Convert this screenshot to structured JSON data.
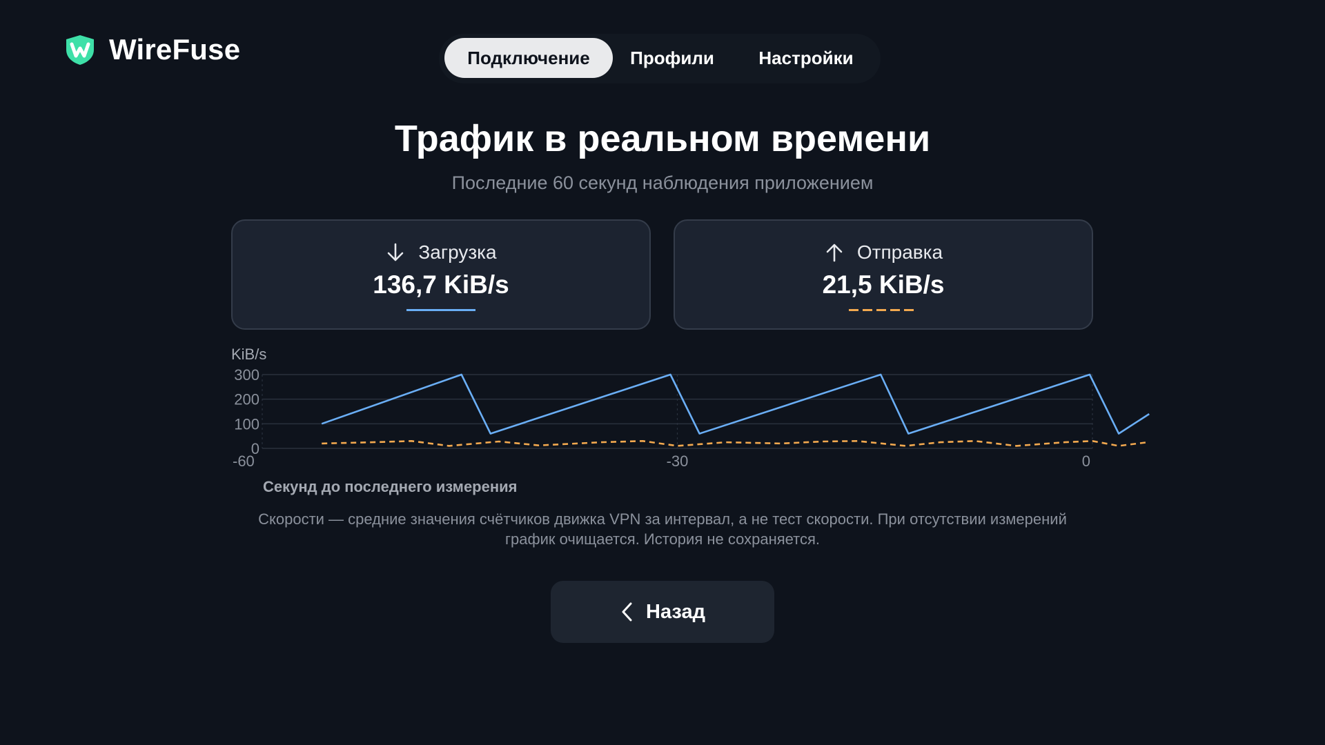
{
  "app": {
    "name": "WireFuse",
    "accent_color": "#3ee0a8"
  },
  "tabs": [
    {
      "label": "Подключение",
      "active": true
    },
    {
      "label": "Профили",
      "active": false
    },
    {
      "label": "Настройки",
      "active": false
    }
  ],
  "header": {
    "title": "Трафик в реальном времени",
    "subtitle": "Последние 60 секунд наблюдения приложением"
  },
  "stats": {
    "download": {
      "label": "Загрузка",
      "value": "136,7 KiB/s",
      "icon": "arrow-down-icon",
      "color": "#6aaef5"
    },
    "upload": {
      "label": "Отправка",
      "value": "21,5 KiB/s",
      "icon": "arrow-up-icon",
      "color": "#f3a94f"
    }
  },
  "chart_data": {
    "type": "line",
    "ylabel": "KiB/s",
    "xlabel": "Секунд до последнего измерения",
    "xlim": [
      -60,
      0
    ],
    "ylim": [
      0,
      300
    ],
    "yticks": [
      0,
      100,
      200,
      300
    ],
    "xticks": [
      -60,
      -30,
      0
    ],
    "grid": true,
    "series": [
      {
        "style": "solid",
        "color": "#6aaef5",
        "x": [
          -55.7,
          -45.6,
          -43.5,
          -30.5,
          -28.4,
          -15.3,
          -13.3,
          -0.2,
          1.9,
          4.1
        ],
        "y": [
          100,
          300,
          60,
          300,
          60,
          300,
          60,
          300,
          60,
          140
        ]
      },
      {
        "style": "dashed",
        "color": "#f3a94f",
        "x": [
          -55.7,
          -52,
          -49.2,
          -46.5,
          -42.9,
          -40,
          -35.5,
          -32.5,
          -30.0,
          -26.5,
          -22.5,
          -19.5,
          -17,
          -13.5,
          -11,
          -8.5,
          -5.5,
          -2.0,
          0,
          1.9,
          4.0
        ],
        "y": [
          20,
          25,
          30,
          10,
          28,
          12,
          25,
          30,
          10,
          25,
          20,
          28,
          30,
          10,
          25,
          30,
          10,
          25,
          30,
          10,
          25
        ]
      }
    ]
  },
  "note": {
    "line1": "Скорости — средние значения счётчиков движка VPN за интервал, а не тест скорости. При отсутствии измерений",
    "line2": "график очищается. История не сохраняется."
  },
  "back_button": {
    "label": "Назад",
    "icon": "chevron-left-icon"
  }
}
